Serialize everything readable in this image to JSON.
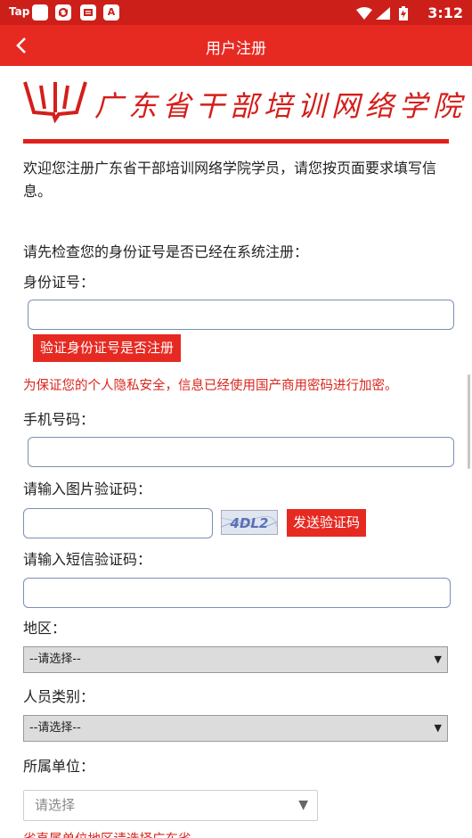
{
  "status_bar": {
    "carrier": "Tap",
    "time": "3:12",
    "icons": [
      "app-icon",
      "sync-icon",
      "message-icon",
      "a-icon",
      "wifi-icon",
      "signal-icon",
      "battery-icon"
    ]
  },
  "appbar": {
    "title": "用户注册",
    "back_icon": "back-arrow-icon"
  },
  "banner": {
    "school_name": "广东省干部培训网络学院"
  },
  "intro": "欢迎您注册广东省干部培训网络学院学员，请您按页面要求填写信息。",
  "check_prompt": "请先检查您的身份证号是否已经在系统注册：",
  "id_label": "身份证号：",
  "id_value": "",
  "verify_button": "验证身份证号是否注册",
  "privacy_notice": "为保证您的个人隐私安全，信息已经使用国产商用密码进行加密。",
  "phone_label": "手机号码：",
  "phone_value": "",
  "captcha_label": "请输入图片验证码：",
  "captcha_value": "",
  "captcha_text": "4DL2",
  "send_code_button": "发送验证码",
  "sms_label": "请输入短信验证码：",
  "sms_value": "",
  "region_label": "地区：",
  "region_selected": "--请选择--",
  "category_label": "人员类别：",
  "category_selected": "--请选择--",
  "unit_label": "所属单位：",
  "unit_placeholder": "请选择",
  "cut_notice": "省直属单位地区请选择广东省",
  "colors": {
    "brand_red": "#e62a22",
    "status_red": "#cc1f1a",
    "notice_red": "#d8261d"
  }
}
